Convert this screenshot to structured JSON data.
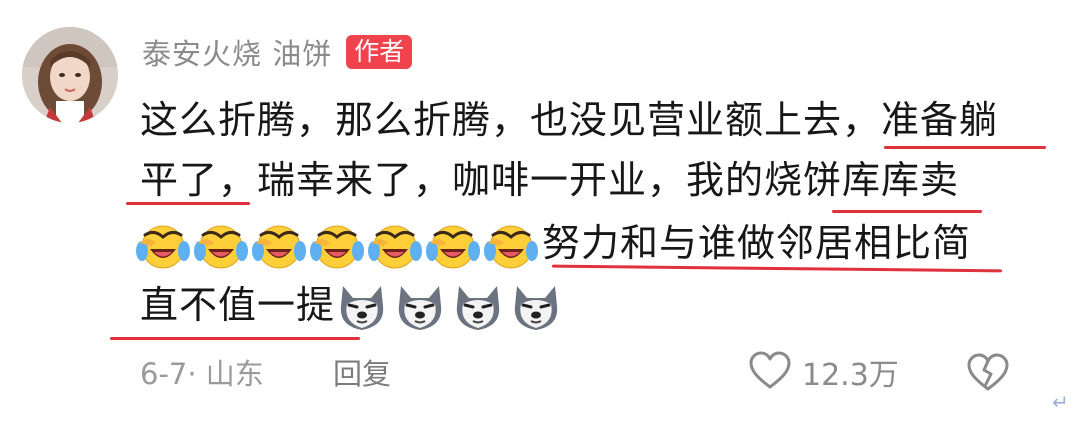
{
  "comment": {
    "author": "泰安火烧 油饼",
    "badge": "作者",
    "line1": "这么折腾，那么折腾，也没见营业额上去，准备躺",
    "line2": "平了，瑞幸来了，咖啡一开业，我的烧饼库库卖",
    "line3_text": "努力和与谁做邻居相比简",
    "line4_text": "直不值一提",
    "date_location": "6-7· 山东",
    "reply_label": "回复",
    "like_count": "12.3万",
    "line_break_glyph": "↵"
  },
  "emojis": {
    "crying_laugh_count": 7,
    "dog_count": 4
  },
  "colors": {
    "badge": "#f0434d",
    "underline": "#e0313c",
    "meta_text": "#9a9a9a"
  },
  "icons": [
    "avatar-photo",
    "crying-laugh-emoji",
    "dog-emoji",
    "heart-icon",
    "broken-heart-icon"
  ]
}
